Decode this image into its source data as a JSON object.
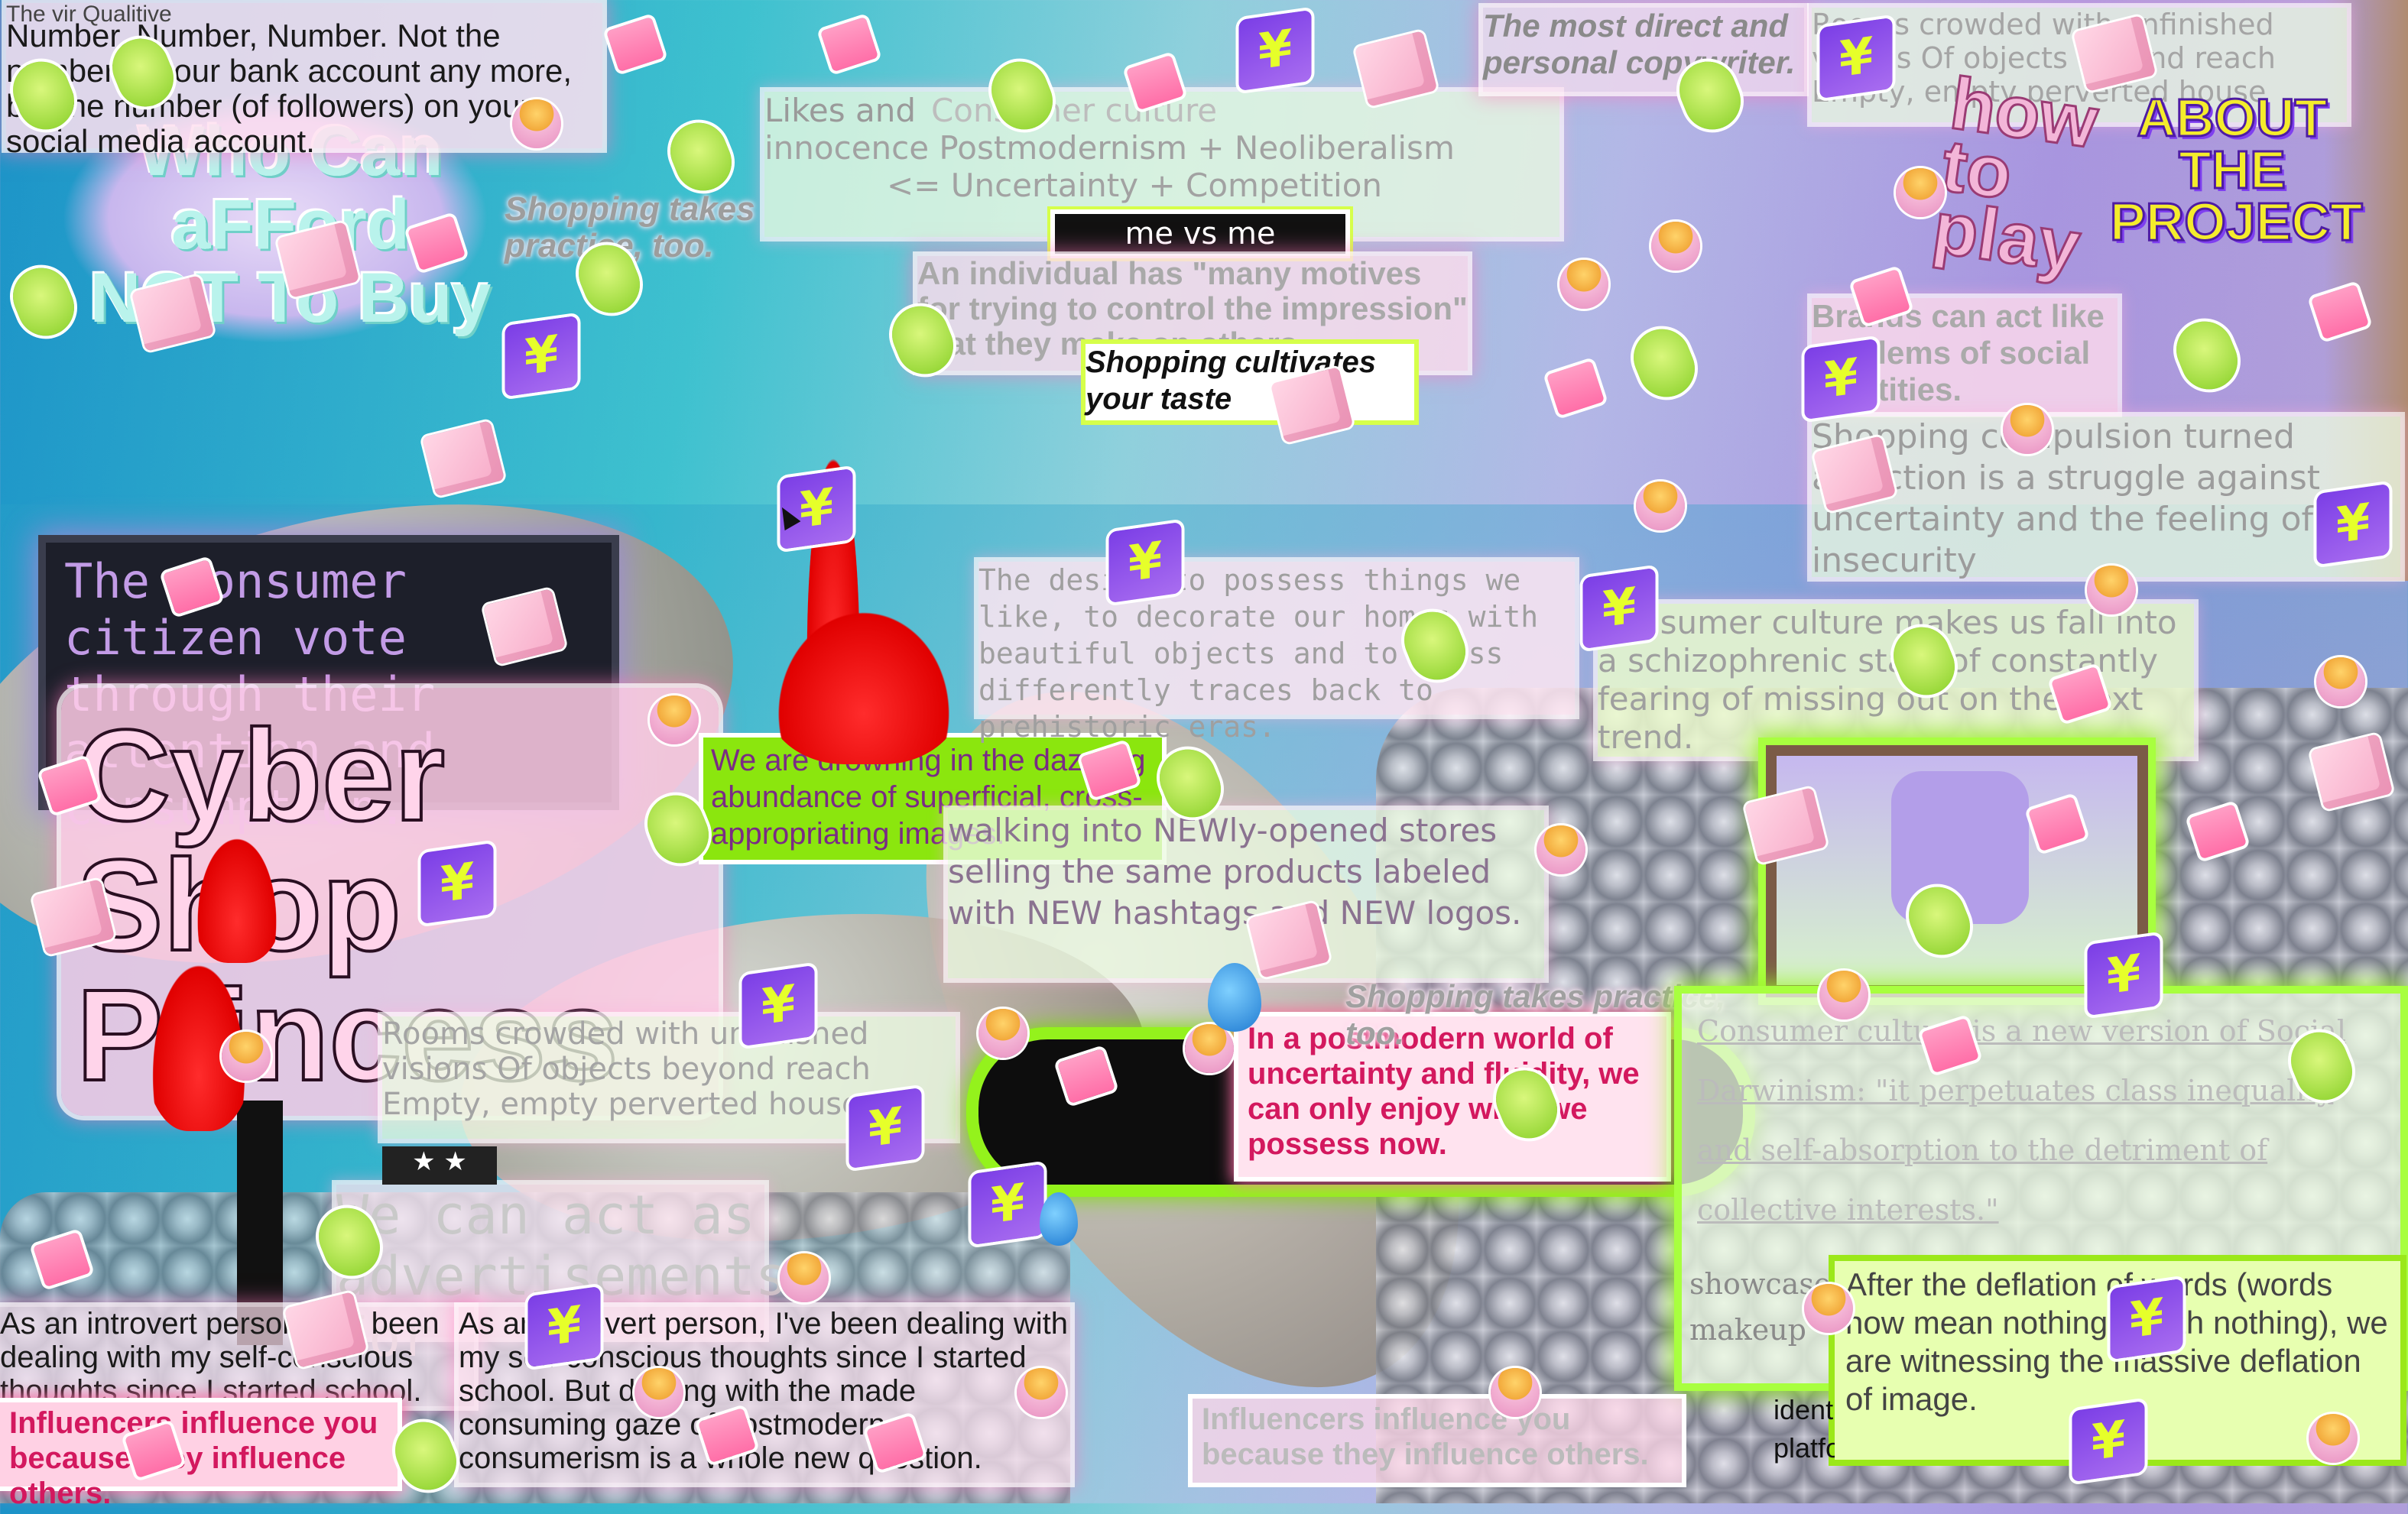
{
  "top_left_text": {
    "heading_partial": "The vir Qualitive",
    "body": "Number, Number, Number. Not the number in your bank account any more, but the number (of followers) on your social media account."
  },
  "who_can_afford": {
    "line1": "Who Can",
    "line2": "aFFord",
    "line3": "NOT To Buy"
  },
  "likes_box": {
    "line1": "Likes and",
    "line1b": "Consumer culture",
    "line2": "innocence Postmodernism + Neoliberalism",
    "line3": "<= Uncertainty + Competition",
    "line4": "me vs me"
  },
  "shopping_practice_1": "Shopping takes practice, too.",
  "individual_quote": "An individual has \"many motives for trying to control the impression\" that they make on others.",
  "shopping_cultivates": "Shopping cultivates your taste",
  "most_direct": "The most direct and personal copywriter.",
  "rooms_top": "Rooms crowded with unfinished visions Of objects beyond reach Empty, empty perverted house",
  "how_to_play": "how to play",
  "about_project": "ABOUT THE PROJECT",
  "brands_act": "Brands can act like emblems of social identities.",
  "shopping_compulsion": "Shopping compulsion turned addiction is a struggle against uncertainty and the feeling of insecurity",
  "consumer_citizen": "The consumer citizen vote through their attention and consumption.",
  "desire_possess": "The desire to possess things we like, to decorate our homes with beautiful objects and to dress differently traces back to prehistoric eras.",
  "consumer_culture_fall": "Consumer culture makes us fall into a schizophrenic state of constantly fearing of missing out on the next trend.",
  "drowning": "We are drowning in the dazzling abundance of superficial, cross-appropriating images.",
  "walking_into": "walking into NEWly-opened stores selling the same products labeled with NEW hashtags and NEW logos.",
  "cyber_title": {
    "line1": "Cyber Shop",
    "line2": "Princess"
  },
  "rooms_bottom": "Rooms crowded with unfinished visions Of objects beyond reach Empty, empty perverted house",
  "shopping_practice_2": "Shopping takes practice, too.",
  "postmodern_world": "In a postmodern world of uncertainty and fluidity, we can only enjoy what we possess now.",
  "consumer_darwinism": "Consumer culture is a new version of Social Darwinism: \"it perpetuates class inequality and self-absorption to the detriment of collective interests.\"",
  "showcase_partial": "showcase makeup",
  "deflation": "After the deflation of words (words now mean nothing, worth nothing), we are witnessing the massive deflation of image.",
  "deflation_partial": "identity platform color",
  "we_can_act": "We can act as advertisements for",
  "introvert_1": "As an introvert person, I've been dealing with my self-conscious thoughts since I started school. But dealing with the",
  "introvert_2": "As an introvert person, I've been dealing with my self-conscious thoughts since I started school. But dealing with the made consuming gaze of postmodern consumerism is a whole new question.",
  "influencers_1": "Influencers influence you because they influence others.",
  "influencers_2": "Influencers influence you because they influence others.",
  "yen_symbol": "¥",
  "colors": {
    "hot_pink": "#d3185e",
    "neon_green": "#8be60e",
    "yellow": "#f4ec2c",
    "purple": "#7b3ee6"
  }
}
